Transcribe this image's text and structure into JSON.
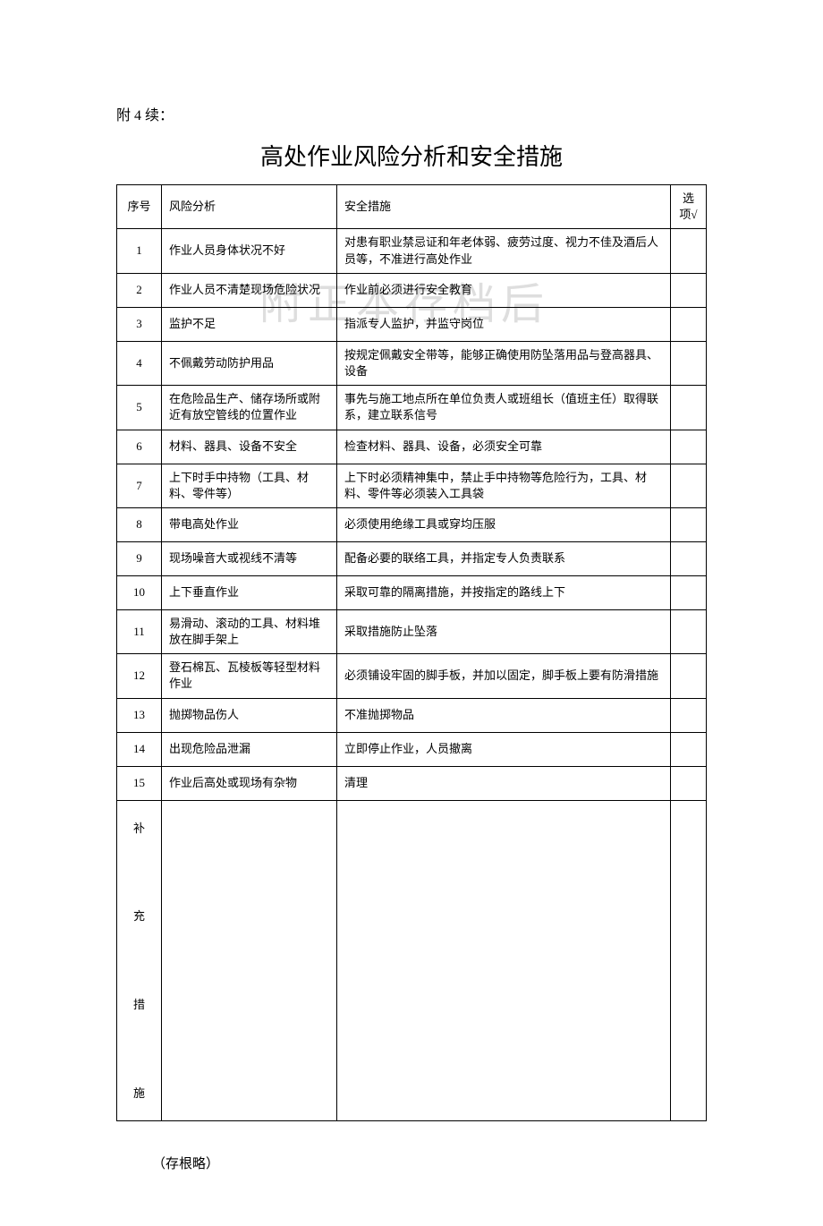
{
  "prefix": "附 4 续：",
  "title": "高处作业风险分析和安全措施",
  "watermark": "附正本存档后",
  "headers": {
    "seq": "序号",
    "risk": "风险分析",
    "measure": "安全措施",
    "check": "选项√"
  },
  "rows": [
    {
      "seq": "1",
      "risk": "作业人员身体状况不好",
      "measure": "对患有职业禁忌证和年老体弱、疲劳过度、视力不佳及酒后人员等，不准进行高处作业"
    },
    {
      "seq": "2",
      "risk": "作业人员不清楚现场危险状况",
      "measure": "作业前必须进行安全教育"
    },
    {
      "seq": "3",
      "risk": "监护不足",
      "measure": "指派专人监护，并监守岗位"
    },
    {
      "seq": "4",
      "risk": "不佩戴劳动防护用品",
      "measure": "按规定佩戴安全带等，能够正确使用防坠落用品与登高器具、设备"
    },
    {
      "seq": "5",
      "risk": "在危险品生产、储存场所或附近有放空管线的位置作业",
      "measure": "事先与施工地点所在单位负责人或班组长（值班主任）取得联系，建立联系信号"
    },
    {
      "seq": "6",
      "risk": "材料、器具、设备不安全",
      "measure": "检查材料、器具、设备，必须安全可靠"
    },
    {
      "seq": "7",
      "risk": "上下时手中持物（工具、材料、零件等）",
      "measure": "上下时必须精神集中，禁止手中持物等危险行为，工具、材料、零件等必须装入工具袋"
    },
    {
      "seq": "8",
      "risk": "带电高处作业",
      "measure": "必须使用绝缘工具或穿均压服"
    },
    {
      "seq": "9",
      "risk": "现场噪音大或视线不清等",
      "measure": "配备必要的联络工具，并指定专人负责联系"
    },
    {
      "seq": "10",
      "risk": "上下垂直作业",
      "measure": "采取可靠的隔离措施，并按指定的路线上下"
    },
    {
      "seq": "11",
      "risk": "易滑动、滚动的工具、材料堆放在脚手架上",
      "measure": "采取措施防止坠落"
    },
    {
      "seq": "12",
      "risk": "登石棉瓦、瓦棱板等轻型材料作业",
      "measure": "必须铺设牢固的脚手板，并加以固定，脚手板上要有防滑措施"
    },
    {
      "seq": "13",
      "risk": "抛掷物品伤人",
      "measure": "不准抛掷物品"
    },
    {
      "seq": "14",
      "risk": "出现危险品泄漏",
      "measure": "立即停止作业，人员撤离"
    },
    {
      "seq": "15",
      "risk": "作业后高处或现场有杂物",
      "measure": "清理"
    }
  ],
  "supplement_label": "补\n\n充\n\n措\n\n施",
  "footnote": "（存根略）"
}
